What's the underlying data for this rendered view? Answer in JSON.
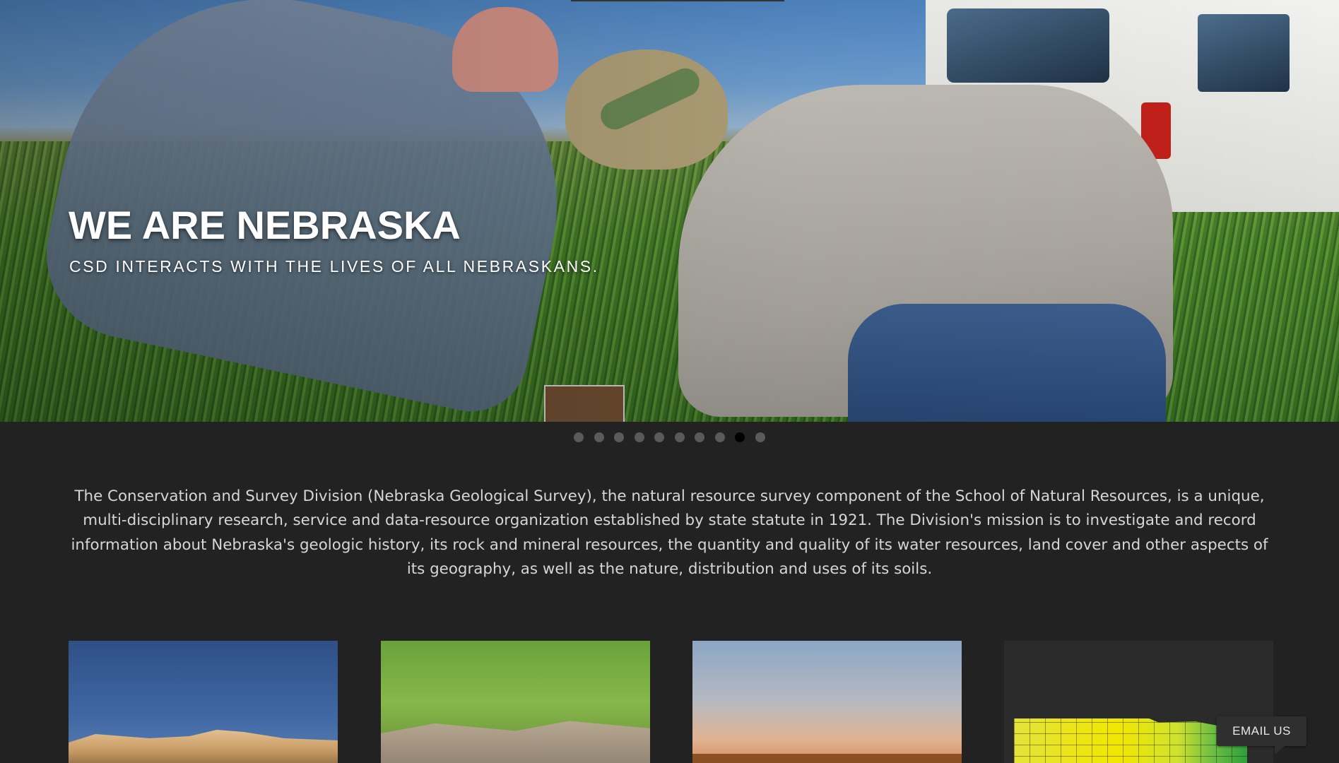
{
  "hero": {
    "title": "WE ARE NEBRASKA",
    "subtitle": "CSD INTERACTS WITH THE LIVES OF ALL NEBRASKANS."
  },
  "carousel": {
    "slide_count": 10,
    "active_index": 8
  },
  "intro": {
    "text": "The Conservation and Survey Division (Nebraska Geological Survey), the natural resource survey component of the School of Natural Resources, is a unique, multi-disciplinary research, service and data-resource organization established by state statute in 1921. The Division's mission is to investigate and record information about Nebraska's geologic history, its rock and mineral resources, the quantity and quality of its water resources, land cover and other aspects of its geography, as well as the nature, distribution and uses of its soils."
  },
  "email_button": {
    "label": "EMAIL US"
  },
  "colors": {
    "page_background": "#222222",
    "intro_text": "#d6d6d6",
    "dot_inactive": "#5a5a5a",
    "dot_active": "#000000"
  }
}
